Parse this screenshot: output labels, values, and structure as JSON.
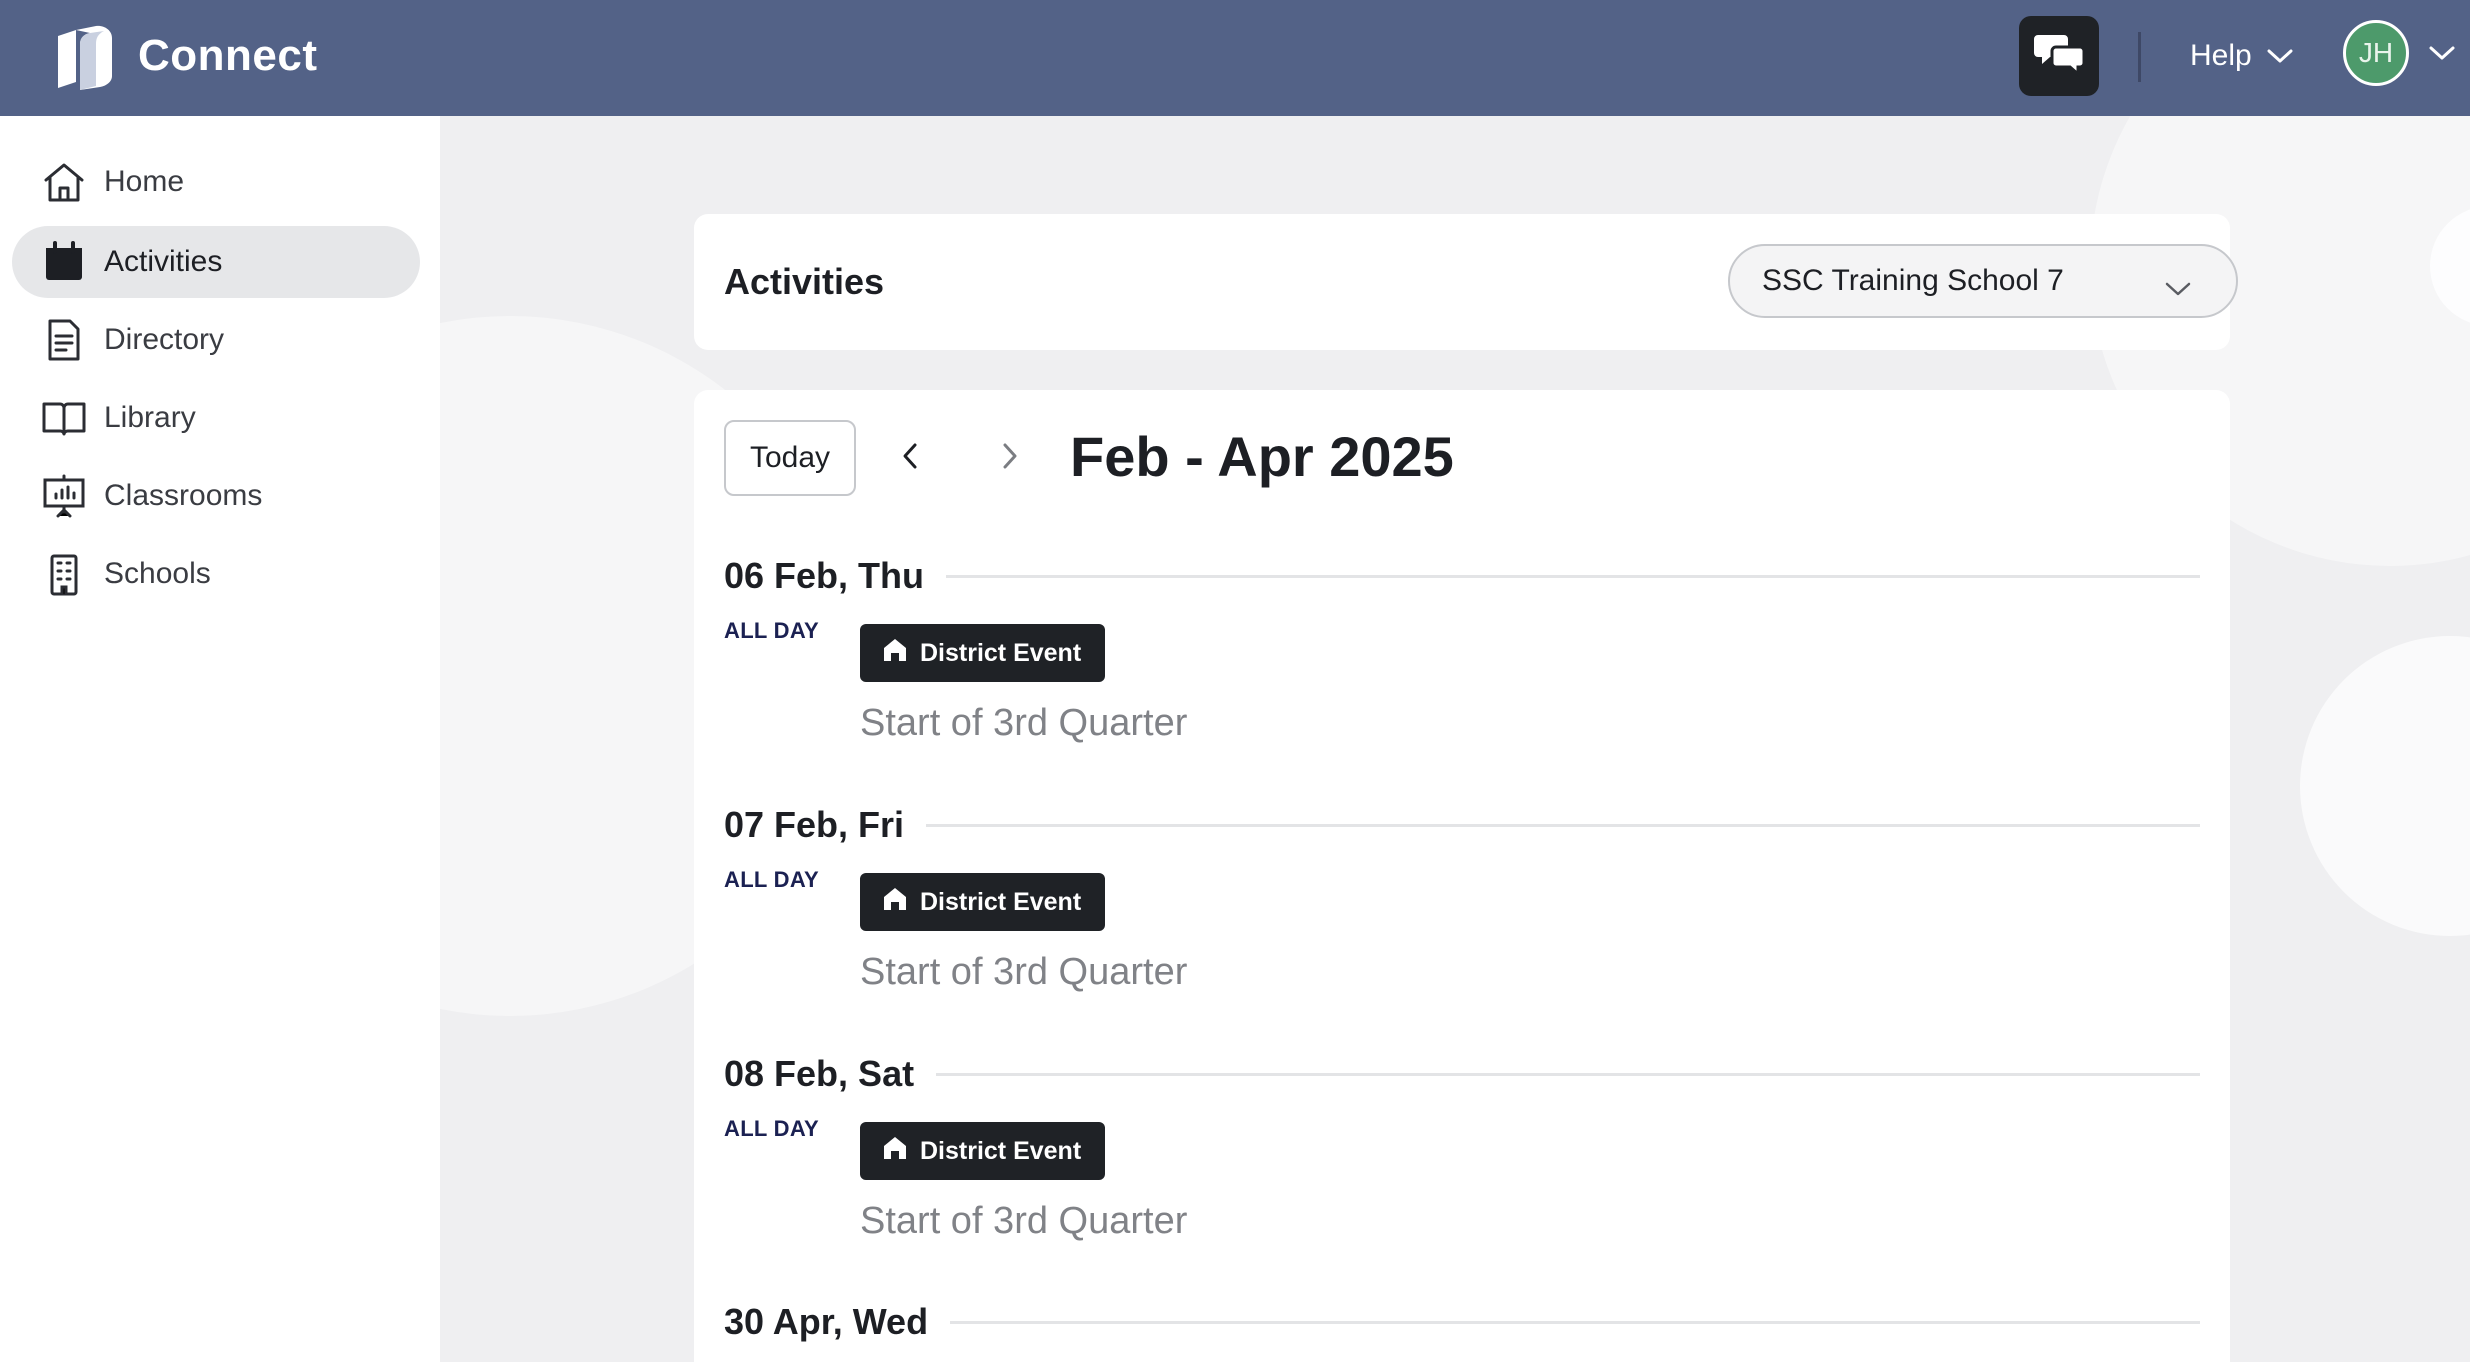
{
  "app": {
    "title": "Connect"
  },
  "topbar": {
    "help_label": "Help",
    "avatar_initials": "JH",
    "chat_icon": "chat-bubbles-icon"
  },
  "sidebar": {
    "items": [
      {
        "label": "Home",
        "icon": "home-icon",
        "active": false
      },
      {
        "label": "Activities",
        "icon": "calendar-icon",
        "active": true
      },
      {
        "label": "Directory",
        "icon": "document-icon",
        "active": false
      },
      {
        "label": "Library",
        "icon": "book-icon",
        "active": false
      },
      {
        "label": "Classrooms",
        "icon": "presentation-board-icon",
        "active": false
      },
      {
        "label": "Schools",
        "icon": "building-icon",
        "active": false
      }
    ]
  },
  "main": {
    "page_title": "Activities",
    "school_select": {
      "value": "SSC Training School 7"
    },
    "calendar": {
      "today_label": "Today",
      "range_title": "Feb - Apr 2025",
      "days": [
        {
          "label": "06 Feb, Thu",
          "time": "ALL DAY",
          "event_type": "District Event",
          "event_title": "Start of 3rd Quarter"
        },
        {
          "label": "07 Feb, Fri",
          "time": "ALL DAY",
          "event_type": "District Event",
          "event_title": "Start of 3rd Quarter"
        },
        {
          "label": "08 Feb, Sat",
          "time": "ALL DAY",
          "event_type": "District Event",
          "event_title": "Start of 3rd Quarter"
        },
        {
          "label": "30 Apr, Wed"
        }
      ]
    }
  },
  "colors": {
    "topbar": "#536287",
    "avatar": "#4d9a6b",
    "chip": "#1f2226",
    "all_day": "#1b2152"
  }
}
